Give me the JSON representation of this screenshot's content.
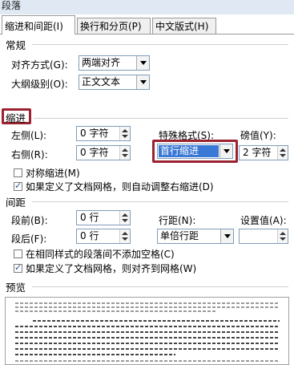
{
  "window": {
    "title": "段落"
  },
  "tabs": [
    {
      "label": "缩进和间距(I)"
    },
    {
      "label": "换行和分页(P)"
    },
    {
      "label": "中文版式(H)"
    }
  ],
  "general": {
    "heading": "常规",
    "alignment": {
      "label": "对齐方式(G):",
      "value": "两端对齐"
    },
    "outline": {
      "label": "大纲级别(O):",
      "value": "正文文本"
    }
  },
  "indent": {
    "heading": "缩进",
    "left": {
      "label": "左侧(L):",
      "value": "0 字符"
    },
    "right": {
      "label": "右侧(R):",
      "value": "0 字符"
    },
    "special": {
      "label": "特殊格式(S):",
      "value": "首行缩进"
    },
    "by": {
      "label": "磅值(Y):",
      "value": "2 字符"
    },
    "mirror": {
      "label": "对称缩进(M)",
      "checked": false
    },
    "auto_adjust": {
      "label": "如果定义了文档网格，则自动调整右缩进(D)",
      "checked": true
    }
  },
  "spacing": {
    "heading": "间距",
    "before": {
      "label": "段前(B):",
      "value": "0 行"
    },
    "after": {
      "label": "段后(F):",
      "value": "0 行"
    },
    "line_spacing": {
      "label": "行距(N):",
      "value": "单倍行距"
    },
    "at": {
      "label": "设置值(A):",
      "value": ""
    },
    "no_space_same_style": {
      "label": "在相同样式的段落间不添加空格(C)",
      "checked": false
    },
    "snap_to_grid": {
      "label": "如果定义了文档网格，则对齐到网格(W)",
      "checked": true
    }
  },
  "preview": {
    "heading": "预览"
  },
  "colors": {
    "highlight": "#3a78d6",
    "red_annotation": "#9b2230"
  }
}
